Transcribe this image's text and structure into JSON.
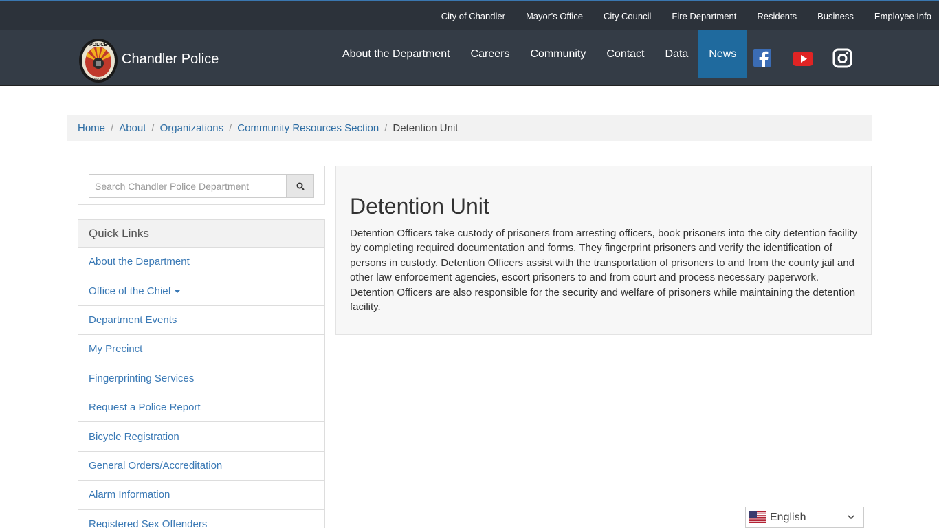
{
  "topbar": {
    "links": [
      "City of Chandler",
      "Mayor’s Office",
      "City Council",
      "Fire Department",
      "Residents",
      "Business",
      "Employee Info"
    ]
  },
  "header": {
    "brand": "Chandler Police",
    "logo_text": [
      "POLICE",
      "ARIZONA"
    ],
    "nav": [
      "About the Department",
      "Careers",
      "Community",
      "Contact",
      "Data",
      "News"
    ],
    "active_nav": "News",
    "social_icons": [
      "facebook-icon",
      "youtube-icon",
      "instagram-icon"
    ]
  },
  "breadcrumb": {
    "links": [
      "Home",
      "About",
      "Organizations",
      "Community Resources Section"
    ],
    "current": "Detention Unit"
  },
  "search": {
    "placeholder": "Search Chandler Police Department",
    "value": "",
    "icon": "search-icon"
  },
  "quick_links": {
    "title": "Quick Links",
    "items": [
      "About the Department",
      "Office of the Chief",
      "Department Events",
      "My Precinct",
      "Fingerprinting Services",
      "Request a Police Report",
      "Bicycle Registration",
      "General Orders/Accreditation",
      "Alarm Information",
      "Registered Sex Offenders"
    ]
  },
  "main": {
    "title": "Detention Unit",
    "body": "Detention Officers take custody of prisoners from arresting officers, book prisoners into the city detention facility by completing required documentation and forms. They fingerprint prisoners and verify the identification of persons in custody. Detention Officers assist with the transportation of prisoners to and from the county jail and other law enforcement agencies, escort prisoners to and from court and process necessary paperwork. Detention Officers are also responsible for the security and welfare of prisoners while maintaining the detention facility."
  },
  "language": {
    "selected": "English",
    "icon": "us-flag-icon"
  },
  "colors": {
    "topbar_bg": "#2c323a",
    "navbar_bg": "#343c46",
    "active_nav_bg": "#1f6a9e",
    "link": "#3a79b5",
    "panel_bg": "#f7f7f7"
  }
}
